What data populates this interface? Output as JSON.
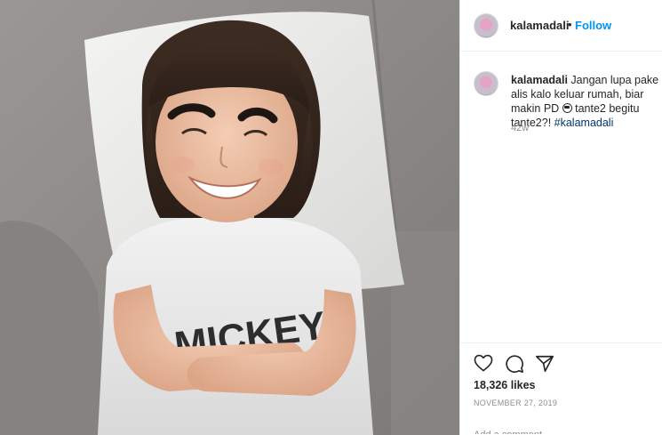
{
  "post": {
    "username": "kalamadali",
    "separator": "•",
    "follow_label": "Follow",
    "caption_text": " Jangan lupa pake alis kalo keluar rumah, biar makin PD ",
    "caption_text_2": " tante2 begitu tante2?! ",
    "hashtag": "#kalamadali",
    "time_ago": "42w",
    "likes": "18,326 likes",
    "date": "NOVEMBER 27, 2019",
    "comment_placeholder": "Add a comment...",
    "shirt_text": "MICKEY"
  },
  "icons": {
    "like": "heart-icon",
    "comment": "comment-icon",
    "share": "paper-plane-icon",
    "caption_emoji": "sunglasses-emoji-icon"
  },
  "colors": {
    "follow": "#0095f6",
    "hashtag": "#00376b",
    "muted": "#8e8e8e",
    "text": "#262626"
  }
}
